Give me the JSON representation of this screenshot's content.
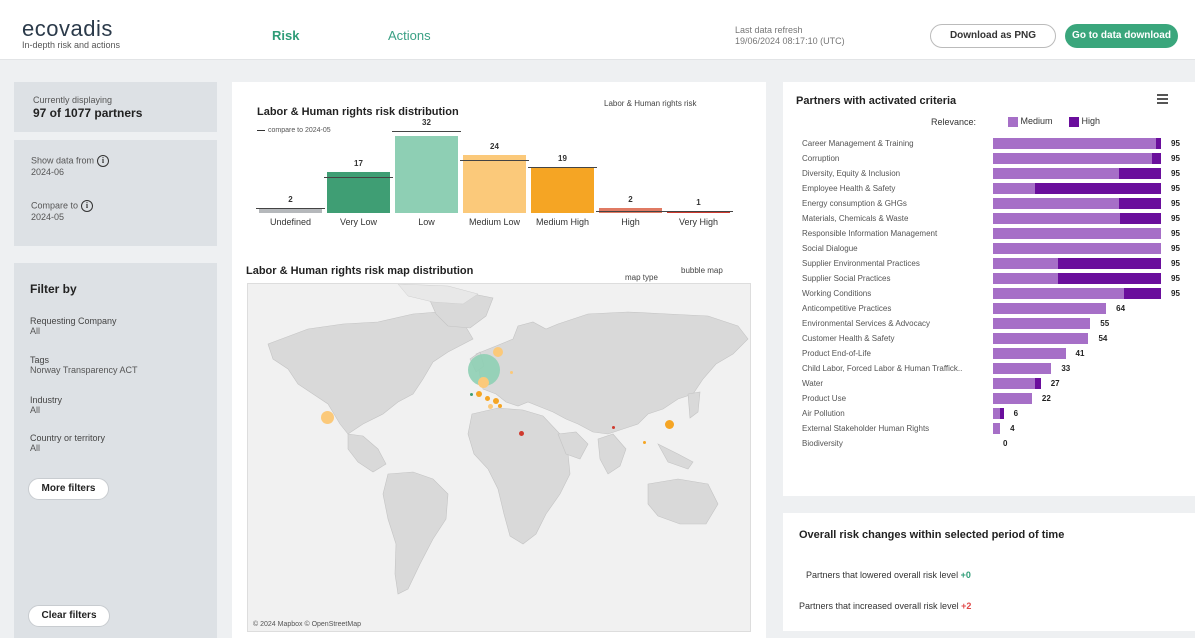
{
  "header": {
    "logo": "ecovadis",
    "logo_subtitle": "In-depth risk and actions",
    "tabs": [
      {
        "label": "Risk",
        "active": true
      },
      {
        "label": "Actions",
        "active": false
      }
    ],
    "refresh_label": "Last data refresh",
    "refresh_value": "19/06/2024 08:17:10 (UTC)",
    "download_png": "Download as PNG",
    "go_download": "Go to data download"
  },
  "sidebar": {
    "currently_label": "Currently displaying",
    "currently_value": "97 of  1077 partners",
    "show_from_label": "Show data from",
    "show_from_value": "2024-06",
    "compare_label": "Compare to",
    "compare_value": "2024-05",
    "filter_title": "Filter by",
    "filters": [
      {
        "label": "Requesting Company",
        "value": "All"
      },
      {
        "label": "Tags",
        "value": "Norway Transparency ACT"
      },
      {
        "label": "Industry",
        "value": "All"
      },
      {
        "label": "Country or territory",
        "value": "All"
      }
    ],
    "more_filters": "More filters",
    "clear_filters": "Clear filters"
  },
  "risk_chart": {
    "title": "Labor & Human rights risk distribution",
    "legend_text": "compare to 2024-05",
    "selector_label": "Labor & Human rights risk"
  },
  "map": {
    "title": "Labor & Human rights risk map distribution",
    "type_label": "map type",
    "type_value": "bubble map",
    "attribution": "© 2024 Mapbox © OpenStreetMap"
  },
  "partners": {
    "title": "Partners with activated criteria",
    "menu_icon": "hamburger-menu-icon",
    "relevance_label": "Relevance:",
    "legend": [
      {
        "label": "Medium",
        "color": "#a66fc7"
      },
      {
        "label": "High",
        "color": "#6a0e9c"
      }
    ]
  },
  "overall": {
    "title": "Overall risk changes within selected period of time",
    "lowered_label": "Partners that lowered overall risk level",
    "lowered_value": "+0",
    "increased_label": "Partners that increased overall risk level",
    "increased_value": "+2",
    "colors": {
      "lowered": "#2e9c77",
      "increased": "#e04848"
    }
  },
  "chart_data": [
    {
      "type": "bar",
      "title": "Labor & Human rights risk distribution",
      "categories": [
        "Undefined",
        "Very Low",
        "Low",
        "Medium Low",
        "Medium High",
        "High",
        "Very High"
      ],
      "values": [
        2,
        17,
        32,
        24,
        19,
        2,
        1
      ],
      "compare_values": [
        2,
        15,
        34,
        22,
        19,
        1,
        1
      ],
      "colors": [
        "#b5b8bb",
        "#3f9e74",
        "#8ecfb4",
        "#fbc97a",
        "#f5a524",
        "#e07a63",
        "#cf3a2e"
      ],
      "compare_label": "compare to 2024-05",
      "ylim": [
        0,
        34
      ]
    },
    {
      "type": "bar",
      "orientation": "horizontal",
      "stacked": true,
      "title": "Partners with activated criteria",
      "categories": [
        "Career Management & Training",
        "Corruption",
        "Diversity, Equity & Inclusion",
        "Employee Health & Safety",
        "Energy consumption & GHGs",
        "Materials, Chemicals & Waste",
        "Responsible Information Management",
        "Social Dialogue",
        "Supplier Environmental Practices",
        "Supplier Social Practices",
        "Working Conditions",
        "Anticompetitive Practices",
        "Environmental Services & Advocacy",
        "Customer Health & Safety",
        "Product End-of-Life",
        "Child Labor, Forced Labor & Human Traffick..",
        "Water",
        "Product Use",
        "Air Pollution",
        "External Stakeholder Human Rights",
        "Biodiversity"
      ],
      "series": [
        {
          "name": "Medium",
          "values": [
            92,
            90,
            71,
            24,
            71,
            72,
            95,
            95,
            37,
            37,
            74,
            64,
            55,
            54,
            41,
            33,
            24,
            22,
            4,
            4,
            0
          ]
        },
        {
          "name": "High",
          "values": [
            3,
            5,
            24,
            71,
            24,
            23,
            0,
            0,
            58,
            58,
            21,
            0,
            0,
            0,
            0,
            0,
            3,
            0,
            2,
            0,
            0
          ]
        }
      ],
      "totals": [
        95,
        95,
        95,
        95,
        95,
        95,
        95,
        95,
        95,
        95,
        95,
        64,
        55,
        54,
        41,
        33,
        27,
        22,
        6,
        4,
        0
      ],
      "xlim": [
        0,
        95
      ]
    }
  ]
}
